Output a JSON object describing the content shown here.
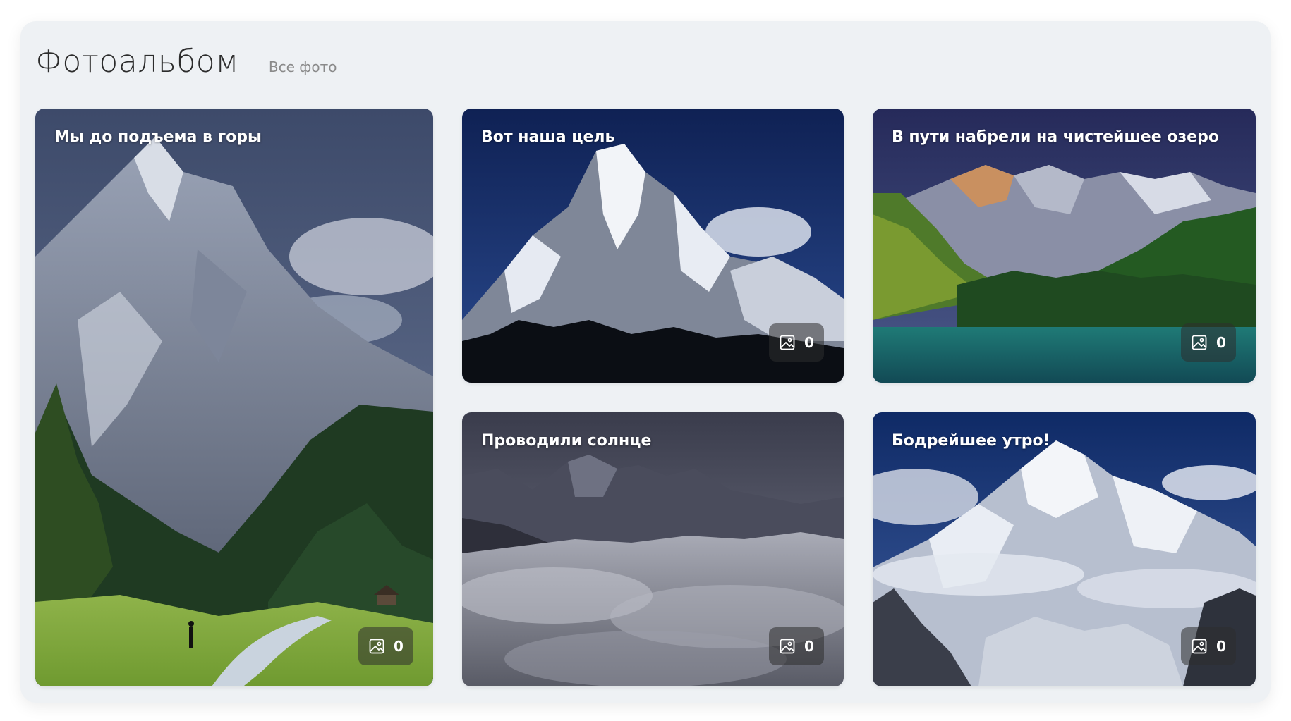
{
  "header": {
    "title": "Фотоальбом",
    "all_photos_link": "Все фото"
  },
  "albums": [
    {
      "title": "Мы до подъема в горы",
      "photo_count": "0",
      "count_icon": "image-icon"
    },
    {
      "title": "Вот наша цель",
      "photo_count": "0",
      "count_icon": "image-icon"
    },
    {
      "title": "В пути набрели на чистейшее озеро",
      "photo_count": "0",
      "count_icon": "image-icon"
    },
    {
      "title": "Проводили солнце",
      "photo_count": "0",
      "count_icon": "image-icon"
    },
    {
      "title": "Бодрейшее утро!",
      "photo_count": "0",
      "count_icon": "image-icon"
    }
  ],
  "colors": {
    "panel_background": "#eef1f4",
    "title_text": "#2c2c2c",
    "link_text": "#8a8a8a",
    "card_text": "#ffffff"
  }
}
